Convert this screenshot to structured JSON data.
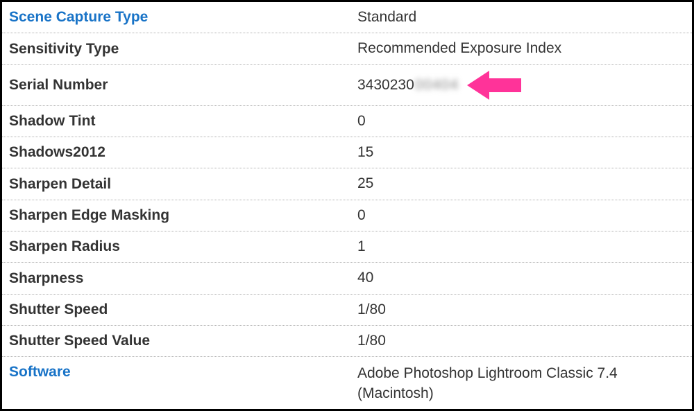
{
  "rows": [
    {
      "label": "Scene Capture Type",
      "value": "Standard",
      "linkLabel": true
    },
    {
      "label": "Sensitivity Type",
      "value": "Recommended Exposure Index"
    },
    {
      "label": "Serial Number",
      "value": "3430230",
      "blurred": "00404",
      "hasArrow": true
    },
    {
      "label": "Shadow Tint",
      "value": "0"
    },
    {
      "label": "Shadows2012",
      "value": "15"
    },
    {
      "label": "Sharpen Detail",
      "value": "25"
    },
    {
      "label": "Sharpen Edge Masking",
      "value": "0"
    },
    {
      "label": "Sharpen Radius",
      "value": "1"
    },
    {
      "label": "Sharpness",
      "value": "40"
    },
    {
      "label": "Shutter Speed",
      "value": "1/80"
    },
    {
      "label": "Shutter Speed Value",
      "value": "1/80"
    },
    {
      "label": "Software",
      "value": "Adobe Photoshop Lightroom Classic 7.4 (Macintosh)",
      "linkLabel": true,
      "tall": true
    }
  ],
  "arrowColor": "#ff3399"
}
